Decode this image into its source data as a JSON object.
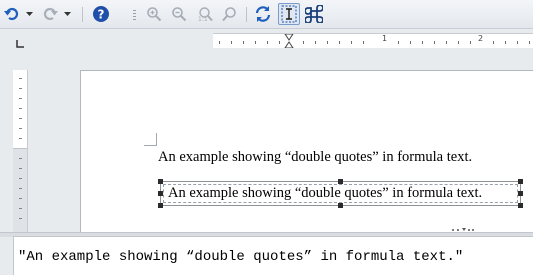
{
  "toolbar": {
    "items": [
      {
        "name": "undo-icon"
      },
      {
        "name": "undo-dropdown-icon"
      },
      {
        "name": "redo-icon"
      },
      {
        "name": "redo-dropdown-icon"
      },
      {
        "name": "help-icon"
      },
      {
        "name": "zoom-in-icon"
      },
      {
        "name": "zoom-out-icon"
      },
      {
        "name": "zoom-100-icon"
      },
      {
        "name": "show-all-icon"
      },
      {
        "name": "update-icon"
      },
      {
        "name": "formula-cursor-icon",
        "active": true
      },
      {
        "name": "symbols-icon"
      }
    ]
  },
  "ruler": {
    "numbers": [
      "1",
      "2"
    ]
  },
  "document": {
    "text_line": "An example showing “double quotes” in formula text.",
    "formula_line": "An example showing “double quotes” in formula text."
  },
  "command": {
    "text": "\"An example showing “double quotes” in formula text.\""
  },
  "colors": {
    "background": "#e8ebee",
    "page": "#ffffff",
    "accent": "#1f5fbf"
  }
}
